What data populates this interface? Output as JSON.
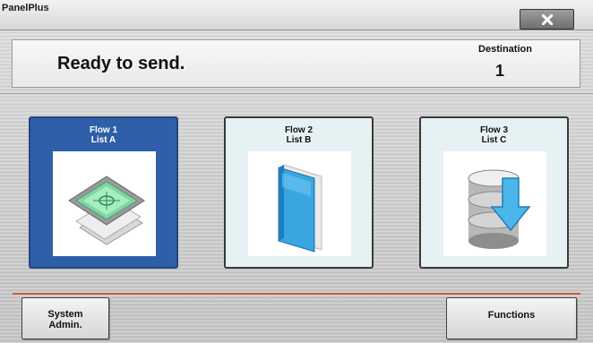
{
  "window": {
    "title": "PanelPlus",
    "close_icon": "close-icon"
  },
  "status": {
    "message": "Ready to send.",
    "destination_label": "Destination",
    "destination_value": "1"
  },
  "flows": [
    {
      "line1": "Flow 1",
      "line2": "List A",
      "icon": "scanner-icon",
      "selected": true
    },
    {
      "line1": "Flow 2",
      "line2": "List B",
      "icon": "book-icon",
      "selected": false
    },
    {
      "line1": "Flow 3",
      "line2": "List C",
      "icon": "database-download-icon",
      "selected": false
    }
  ],
  "footer": {
    "system_admin_line1": "System",
    "system_admin_line2": "Admin.",
    "functions_label": "Functions"
  },
  "colors": {
    "selected_tile": "#2f5fa8",
    "tile_bg": "#e6f1f3",
    "accent_line": "#d15a3a"
  }
}
